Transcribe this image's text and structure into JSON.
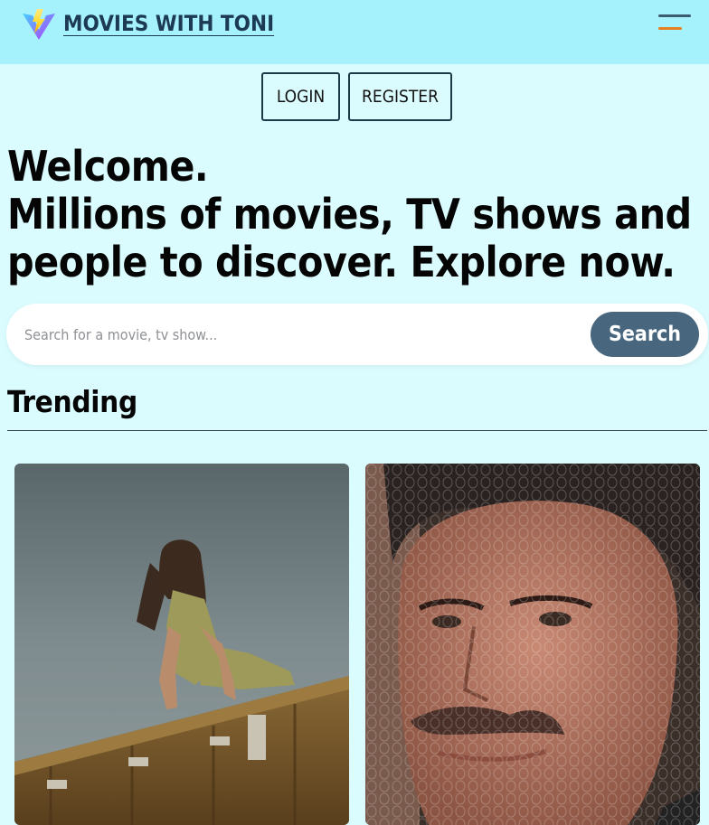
{
  "header": {
    "site_title": "MOVIES WITH TONI",
    "logo_icon": "vite-logo-icon",
    "menu_icon": "hamburger-menu-icon",
    "colors": {
      "background": "#a5f1fc",
      "title": "#1d3a55",
      "menu_bar_top": "#3c5b70",
      "menu_bar_bottom": "#e6801e"
    }
  },
  "auth": {
    "login_label": "LOGIN",
    "register_label": "REGISTER"
  },
  "hero": {
    "line1": "Welcome.",
    "line2": "Millions of movies, TV shows and",
    "line3": "people to discover. Explore now."
  },
  "search": {
    "placeholder": "Search for a movie, tv show...",
    "value": "",
    "button_label": "Search",
    "button_color": "#48677f"
  },
  "trending": {
    "title": "Trending",
    "items": [
      {
        "poster_icon": "movie-poster-woman-on-shipping-container"
      },
      {
        "poster_icon": "movie-poster-man-with-mustache"
      }
    ]
  },
  "page_background": "#dbfcff"
}
